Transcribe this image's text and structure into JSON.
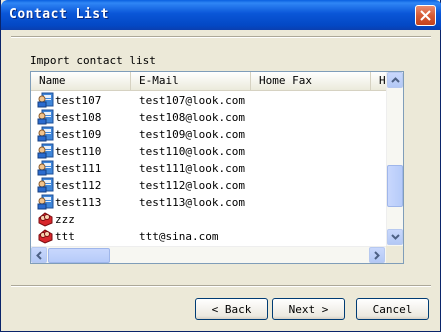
{
  "window": {
    "title": "Contact List"
  },
  "group": {
    "label": "Import contact list"
  },
  "list": {
    "columns": [
      "Name",
      "E-Mail",
      "Home Fax",
      "H"
    ],
    "rows": [
      {
        "name": "test107",
        "email": "test107@look.com",
        "icon": "contact-card-icon"
      },
      {
        "name": "test108",
        "email": "test108@look.com",
        "icon": "contact-card-icon"
      },
      {
        "name": "test109",
        "email": "test109@look.com",
        "icon": "contact-card-icon"
      },
      {
        "name": "test110",
        "email": "test110@look.com",
        "icon": "contact-card-icon"
      },
      {
        "name": "test111",
        "email": "test111@look.com",
        "icon": "contact-card-icon"
      },
      {
        "name": "test112",
        "email": "test112@look.com",
        "icon": "contact-card-icon"
      },
      {
        "name": "test113",
        "email": "test113@look.com",
        "icon": "contact-card-icon"
      },
      {
        "name": "zzz",
        "email": "",
        "icon": "distribution-list-icon"
      },
      {
        "name": "ttt",
        "email": "ttt@sina.com",
        "icon": "distribution-list-icon"
      }
    ]
  },
  "buttons": {
    "back": "< Back",
    "next": "Next >",
    "cancel": "Cancel"
  },
  "colors": {
    "titlebar": "#0a56d8",
    "face": "#ece9d8",
    "listborder": "#7f9db9"
  }
}
